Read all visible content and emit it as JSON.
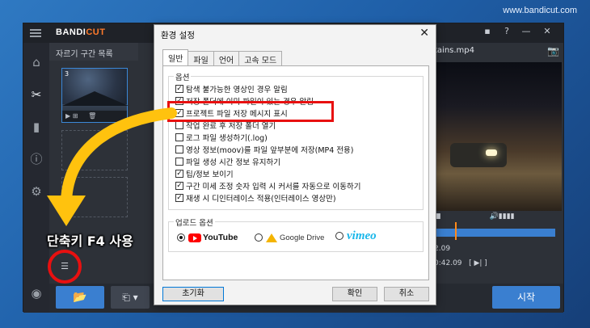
{
  "watermark": "www.bandicut.com",
  "app": {
    "logo_main": "BANDI",
    "logo_accent": "CUT",
    "window_controls": [
      "▪",
      "?",
      "—",
      "✕"
    ],
    "panel_title": "자르기 구간 목록",
    "thumb_number": "3",
    "file_name": "tains.mp4",
    "time_short": "2.09",
    "time_current": "0:42.09",
    "open_icon": "folder-icon",
    "start_label": "시작"
  },
  "dialog": {
    "title": "환경 설정",
    "close": "✕",
    "tabs": [
      "일반",
      "파일",
      "언어",
      "고속 모드"
    ],
    "options_group": "옵션",
    "options": [
      {
        "label": "탐색 불가능한 영상인 경우 알림",
        "checked": true
      },
      {
        "label": "저장 폴더에 이미 파일이 있는 경우 알림",
        "checked": true
      },
      {
        "label": "프로젝트 파일 저장 메시지 표시",
        "checked": true
      },
      {
        "label": "작업 완료 후 저장 폴더 열기",
        "checked": false
      },
      {
        "label": "로그 파일 생성하기(.log)",
        "checked": false
      },
      {
        "label": "영상 정보(moov)를 파일 앞부분에 저장(MP4 전용)",
        "checked": false
      },
      {
        "label": "파일 생성 시간 정보 유지하기",
        "checked": false
      },
      {
        "label": "팁/정보 보이기",
        "checked": true
      },
      {
        "label": "구간 미세 조정 숫자 입력 시 커서를 자동으로 이동하기",
        "checked": true
      },
      {
        "label": "재생 시 디인터레이스 적용(인터레이스 영상만)",
        "checked": true
      }
    ],
    "upload_group": "업로드 옵션",
    "upload": {
      "youtube": "YouTube",
      "google_drive": "Google Drive",
      "vimeo": "vimeo",
      "selected": "youtube"
    },
    "reset_label": "초기화",
    "ok_label": "확인",
    "cancel_label": "취소"
  },
  "annotation": {
    "hotkey_text": "단축키 F4 사용",
    "highlight_color": "#e81010",
    "arrow_color": "#ffc20e"
  }
}
